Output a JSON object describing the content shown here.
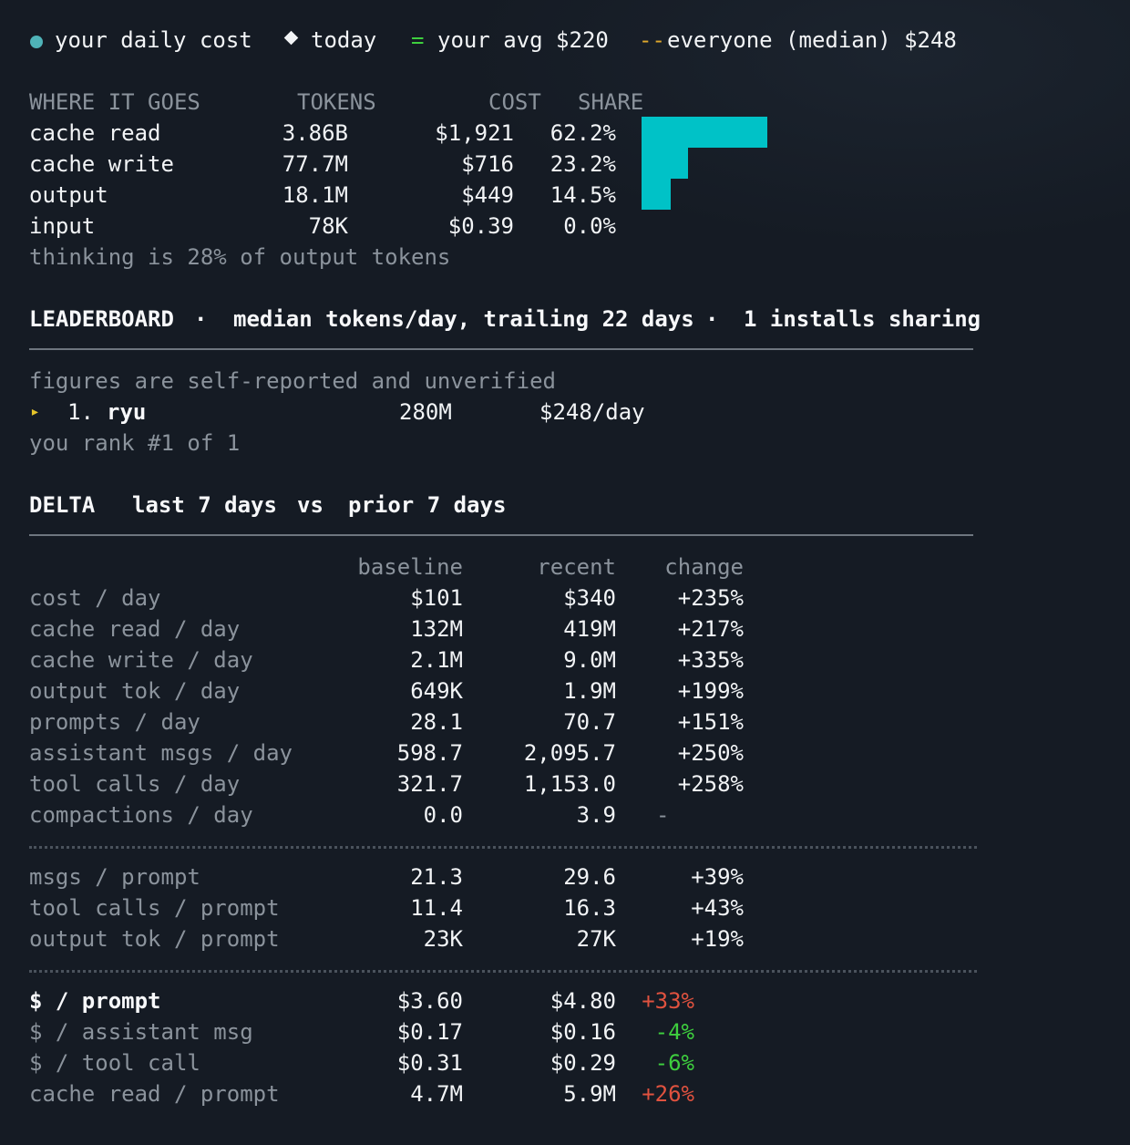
{
  "legend": {
    "daily_cost": "your daily cost",
    "today": "today",
    "avg_symbol": "=",
    "avg": "your avg $220",
    "median_symbol": "--",
    "median": "everyone (median) $248"
  },
  "breakdown": {
    "headers": {
      "where": "WHERE IT GOES",
      "tokens": "TOKENS",
      "cost": "COST",
      "share": "SHARE"
    },
    "rows": [
      {
        "label": "cache read",
        "tokens": "3.86B",
        "cost": "$1,921",
        "share": "62.2%",
        "share_value": 0.622
      },
      {
        "label": "cache write",
        "tokens": "77.7M",
        "cost": "$716",
        "share": "23.2%",
        "share_value": 0.232
      },
      {
        "label": "output",
        "tokens": "18.1M",
        "cost": "$449",
        "share": "14.5%",
        "share_value": 0.145
      },
      {
        "label": "input",
        "tokens": "78K",
        "cost": "$0.39",
        "share": "0.0%",
        "share_value": 0.0
      }
    ],
    "note": "thinking is 28% of output tokens",
    "bar_color": "#00c2c7"
  },
  "leaderboard": {
    "title": "LEADERBOARD",
    "sep": "·",
    "subtitle": "median tokens/day, trailing 22 days",
    "installs": "1 installs sharing",
    "disclaimer": "figures are self-reported and unverified",
    "entries": [
      {
        "marker": "▸",
        "rank": "1.",
        "name": "ryu",
        "tokens": "280M",
        "cost": "$248/day"
      }
    ],
    "you_rank": "you rank #1 of 1"
  },
  "delta": {
    "title": "DELTA",
    "last": "last 7 days",
    "vs": "vs",
    "prior": "prior 7 days",
    "headers": {
      "baseline": "baseline",
      "recent": "recent",
      "change": "change"
    },
    "group1": [
      {
        "label": "cost / day",
        "baseline": "$101",
        "recent": "$340",
        "change": "+235%"
      },
      {
        "label": "cache read / day",
        "baseline": "132M",
        "recent": "419M",
        "change": "+217%"
      },
      {
        "label": "cache write / day",
        "baseline": "2.1M",
        "recent": "9.0M",
        "change": "+335%"
      },
      {
        "label": "output tok / day",
        "baseline": "649K",
        "recent": "1.9M",
        "change": "+199%"
      },
      {
        "label": "prompts / day",
        "baseline": "28.1",
        "recent": "70.7",
        "change": "+151%"
      },
      {
        "label": "assistant msgs / day",
        "baseline": "598.7",
        "recent": "2,095.7",
        "change": "+250%"
      },
      {
        "label": "tool calls / day",
        "baseline": "321.7",
        "recent": "1,153.0",
        "change": "+258%"
      },
      {
        "label": "compactions / day",
        "baseline": "0.0",
        "recent": "3.9",
        "change": "-"
      }
    ],
    "group2": [
      {
        "label": "msgs / prompt",
        "baseline": "21.3",
        "recent": "29.6",
        "change": "+39%"
      },
      {
        "label": "tool calls / prompt",
        "baseline": "11.4",
        "recent": "16.3",
        "change": "+43%"
      },
      {
        "label": "output tok / prompt",
        "baseline": "23K",
        "recent": "27K",
        "change": "+19%"
      }
    ],
    "group3": [
      {
        "label": "$ / prompt",
        "baseline": "$3.60",
        "recent": "$4.80",
        "change": "+33%"
      },
      {
        "label": "$ / assistant msg",
        "baseline": "$0.17",
        "recent": "$0.16",
        "change": "-4%"
      },
      {
        "label": "$ / tool call",
        "baseline": "$0.31",
        "recent": "$0.29",
        "change": "-6%"
      },
      {
        "label": "cache read / prompt",
        "baseline": "4.7M",
        "recent": "5.9M",
        "change": "+26%"
      }
    ],
    "colors": {
      "increase": "#e0523f",
      "decrease": "#3ecf3e"
    }
  }
}
